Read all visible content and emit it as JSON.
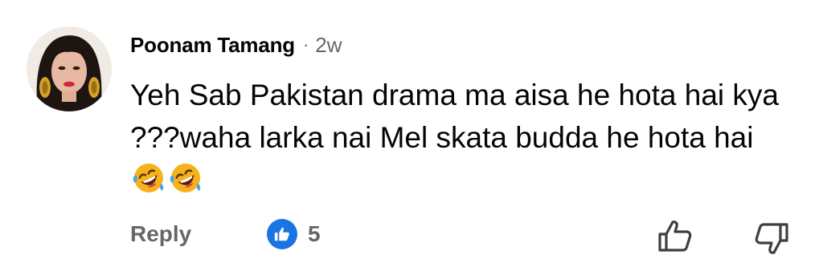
{
  "comment": {
    "author": "Poonam Tamang",
    "separator": "·",
    "time": "2w",
    "text": "Yeh Sab Pakistan drama ma aisa he hota hai kya ???waha larka nai Mel skata budda he hota hai",
    "emojis": [
      "rolling-on-floor-laughing-emoji",
      "rolling-on-floor-laughing-emoji"
    ]
  },
  "actions": {
    "reply_label": "Reply",
    "like_count": "5",
    "like_reaction_icon": "like-reaction-icon",
    "thumbs_up_icon": "thumbs-up-outline-icon",
    "thumbs_down_icon": "thumbs-down-outline-icon"
  },
  "colors": {
    "text": "#050505",
    "secondary_text": "#65676b",
    "like_blue": "#1b74e4",
    "background": "#ffffff"
  }
}
